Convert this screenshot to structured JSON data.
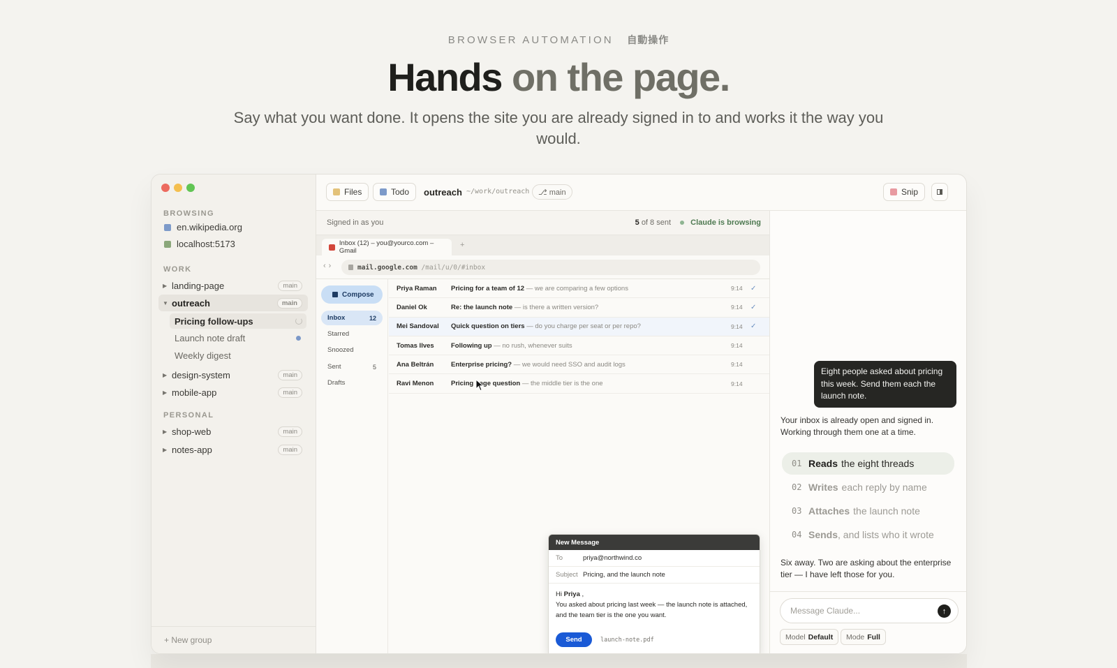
{
  "hero": {
    "eyebrow": "BROWSER AUTOMATION",
    "eyebrow_jp": "自動操作",
    "headline_a": "Hands",
    "headline_b": "on the page.",
    "subtitle": "Say what you want done. It opens the site you are already signed in to and works it the way you would."
  },
  "sidebar": {
    "browsing_label": "BROWSING",
    "sites": [
      {
        "label": "en.wikipedia.org",
        "color": "#7d9ac9"
      },
      {
        "label": "localhost:5173",
        "color": "#8aa77a"
      }
    ],
    "work_label": "WORK",
    "work_groups": [
      {
        "label": "landing-page",
        "badge": "main"
      },
      {
        "label": "outreach",
        "badge": "main"
      }
    ],
    "outreach_children": [
      "Pricing follow-ups",
      "Launch note draft",
      "Weekly digest"
    ],
    "work_groups_more": [
      {
        "label": "design-system",
        "badge": "main"
      },
      {
        "label": "mobile-app",
        "badge": "main"
      }
    ],
    "personal_label": "PERSONAL",
    "personal_groups": [
      {
        "label": "shop-web",
        "badge": "main"
      },
      {
        "label": "notes-app",
        "badge": "main"
      }
    ],
    "new_group": "+ New group"
  },
  "topbar": {
    "files": "Files",
    "todo": "Todo",
    "project": "outreach",
    "path": "~/work/outreach",
    "branch": "⎇ main",
    "snip": "Snip",
    "panel_icon": "panel-toggle-icon"
  },
  "browser": {
    "signed_in": "Signed in as you",
    "sent_count": "5",
    "sent_of": "of 8 sent",
    "browsing_status": "Claude is browsing",
    "tab_title": "Inbox (12) – you@yourco.com – Gmail",
    "tab_plus": "+",
    "url_host": "mail.google.com",
    "url_path": "/mail/u/0/#inbox"
  },
  "gmail": {
    "compose": "Compose",
    "folders": [
      {
        "label": "Inbox",
        "count": "12"
      },
      {
        "label": "Starred",
        "count": ""
      },
      {
        "label": "Snoozed",
        "count": ""
      },
      {
        "label": "Sent",
        "count": "5"
      },
      {
        "label": "Drafts",
        "count": ""
      }
    ],
    "emails": [
      {
        "from": "Priya Raman",
        "subject": "Pricing for a team of 12",
        "snippet": " — we are comparing a few options",
        "time": "9:14",
        "check": "✓"
      },
      {
        "from": "Daniel Ok",
        "subject": "Re: the launch note",
        "snippet": " — is there a written version?",
        "time": "9:14",
        "check": "✓"
      },
      {
        "from": "Mei Sandoval",
        "subject": "Quick question on tiers",
        "snippet": " — do you charge per seat or per repo?",
        "time": "9:14",
        "check": "✓"
      },
      {
        "from": "Tomas Ilves",
        "subject": "Following up",
        "snippet": " — no rush, whenever suits",
        "time": "9:14",
        "check": ""
      },
      {
        "from": "Ana Beltrán",
        "subject": "Enterprise pricing?",
        "snippet": " — we would need SSO and audit logs",
        "time": "9:14",
        "check": ""
      },
      {
        "from": "Ravi Menon",
        "subject": "Pricing page question",
        "snippet": " — the middle tier is the one",
        "time": "9:14",
        "check": ""
      }
    ],
    "compose_window": {
      "title": "New Message",
      "to_label": "To",
      "to_value": "priya@northwind.co",
      "subject_label": "Subject",
      "subject_value": "Pricing, and the launch note",
      "greeting_hi": "Hi",
      "greeting_name": "Priya",
      "greeting_comma": ",",
      "body": "You asked about pricing last week — the launch note is attached, and the team tier is the one you want.",
      "send": "Send",
      "attachment": "launch-note.pdf"
    }
  },
  "chat": {
    "user_message": "Eight people asked about pricing this week. Send them each the launch note.",
    "reply_1": "Your inbox is already open and signed in. Working through them one at a time.",
    "steps": [
      {
        "num": "01",
        "verb": "Reads",
        "rest": "the eight threads"
      },
      {
        "num": "02",
        "verb": "Writes",
        "rest": "each reply by name"
      },
      {
        "num": "03",
        "verb": "Attaches",
        "rest": "the launch note"
      },
      {
        "num": "04",
        "verb": "Sends",
        "rest": ", and lists who it wrote"
      }
    ],
    "reply_2": "Six away. Two are asking about the enterprise tier — I have left those for you.",
    "input_placeholder": "Message Claude...",
    "model_label": "Model",
    "model_value": "Default",
    "mode_label": "Mode",
    "mode_value": "Full"
  },
  "colors": {
    "accent_blue": "#1a5ad6",
    "traffic_red": "#ec6a5e",
    "traffic_yellow": "#f4bf4f",
    "traffic_green": "#61c554",
    "files_chip": "#e3c27a",
    "todo_chip": "#7d9ac9",
    "snip_chip": "#e89aa1"
  }
}
